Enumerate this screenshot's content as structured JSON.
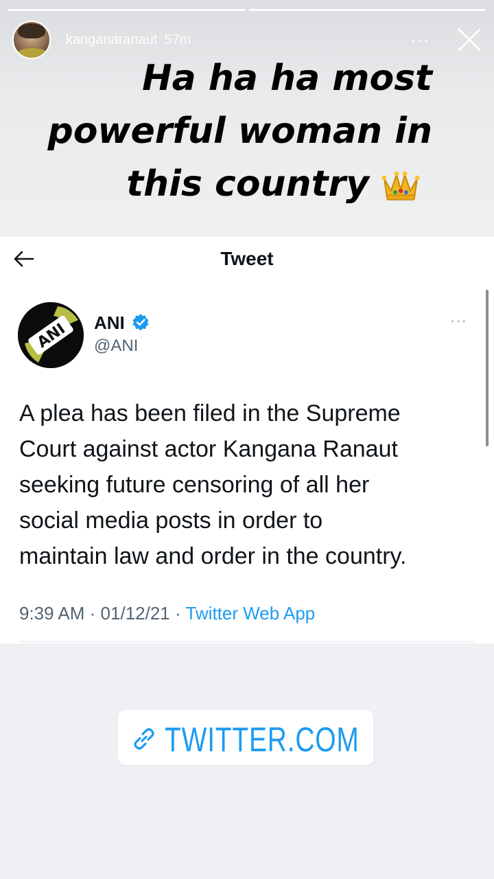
{
  "story": {
    "username": "kanganaranaut",
    "time_ago": "57m",
    "more_label": "···",
    "caption_lines": [
      "Ha ha ha most",
      "powerful woman in",
      "this country"
    ],
    "caption_emoji": "crown-icon"
  },
  "tweet": {
    "header_title": "Tweet",
    "author_name": "ANI",
    "author_handle": "@ANI",
    "logo_text": "ANI",
    "more_label": "···",
    "text_lines": [
      "A plea has been filed in the Supreme",
      "Court against actor Kangana Ranaut",
      "seeking future censoring of all her",
      "social media posts in order to",
      "maintain law and order in the country."
    ],
    "time": "9:39 AM",
    "date": "01/12/21",
    "separator": "·",
    "source_app": "Twitter Web App"
  },
  "link_sticker": {
    "label": "TWITTER.COM"
  },
  "colors": {
    "twitter_blue": "#1d9bf0",
    "text_primary": "#0f1419",
    "text_secondary": "#536471"
  }
}
